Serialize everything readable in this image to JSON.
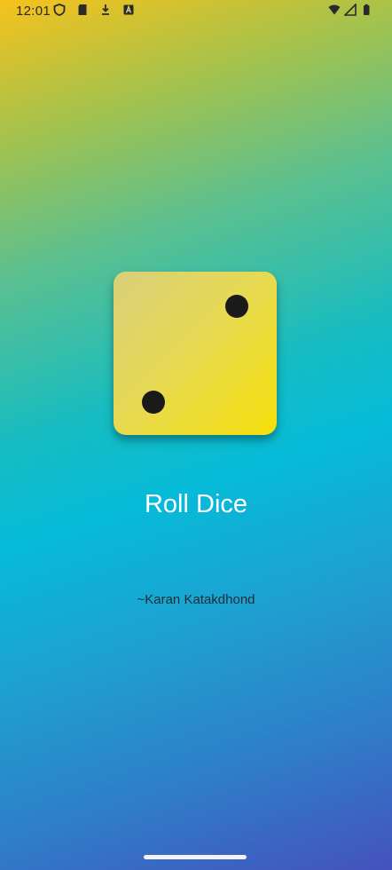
{
  "status_bar": {
    "time": "12:01",
    "left_icons": [
      "shield-icon",
      "sd-card-icon",
      "download-icon",
      "keyboard-icon"
    ],
    "right_icons": [
      "wifi-icon",
      "signal-icon",
      "battery-icon"
    ]
  },
  "dice": {
    "face_value": 2
  },
  "main": {
    "roll_label": "Roll Dice",
    "author": "~Karan Katakdhond"
  }
}
